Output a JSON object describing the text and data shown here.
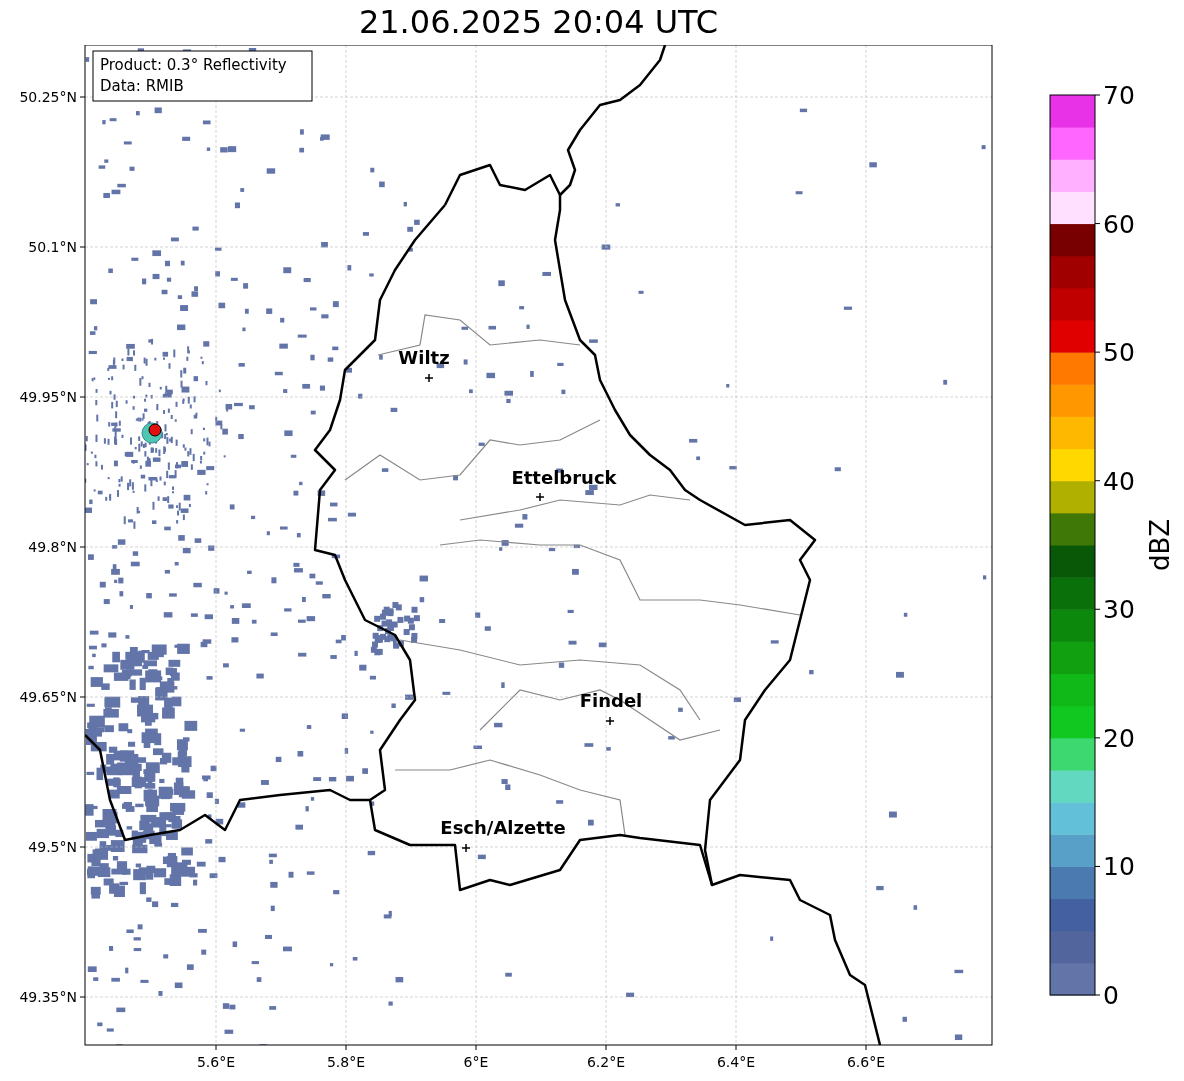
{
  "title": "21.06.2025 20:04 UTC",
  "map": {
    "info_box": [
      "Product: 0.3° Reflectivity",
      "Data: RMIB"
    ],
    "y_ticks": [
      "50.25°N",
      "50.1°N",
      "49.95°N",
      "49.8°N",
      "49.65°N",
      "49.5°N",
      "49.35°N"
    ],
    "x_ticks": [
      "5.6°E",
      "5.8°E",
      "6°E",
      "6.2°E",
      "6.4°E",
      "6.6°E"
    ],
    "cities": [
      {
        "name": "Wiltz"
      },
      {
        "name": "Ettelbruck"
      },
      {
        "name": "Findel"
      },
      {
        "name": "Esch/Alzette"
      }
    ]
  },
  "colorbar": {
    "label": "dBZ",
    "ticks": [
      "70",
      "60",
      "50",
      "40",
      "30",
      "20",
      "10",
      "0"
    ],
    "segments": [
      {
        "color": "#6274a8"
      },
      {
        "color": "#52659c"
      },
      {
        "color": "#4460a0"
      },
      {
        "color": "#4a7ab0"
      },
      {
        "color": "#58a0c8"
      },
      {
        "color": "#62c0d8"
      },
      {
        "color": "#62d8c0"
      },
      {
        "color": "#3ed870"
      },
      {
        "color": "#10c820"
      },
      {
        "color": "#10b818"
      },
      {
        "color": "#10a010"
      },
      {
        "color": "#0c880c"
      },
      {
        "color": "#0a700a"
      },
      {
        "color": "#085808"
      },
      {
        "color": "#407808"
      },
      {
        "color": "#b0b000"
      },
      {
        "color": "#ffd800"
      },
      {
        "color": "#ffb800"
      },
      {
        "color": "#ff9800"
      },
      {
        "color": "#ff7800"
      },
      {
        "color": "#e00000"
      },
      {
        "color": "#c00000"
      },
      {
        "color": "#a00000"
      },
      {
        "color": "#780000"
      },
      {
        "color": "#ffe0ff"
      },
      {
        "color": "#ffb0ff"
      },
      {
        "color": "#ff66ff"
      },
      {
        "color": "#e832e8"
      }
    ]
  }
}
